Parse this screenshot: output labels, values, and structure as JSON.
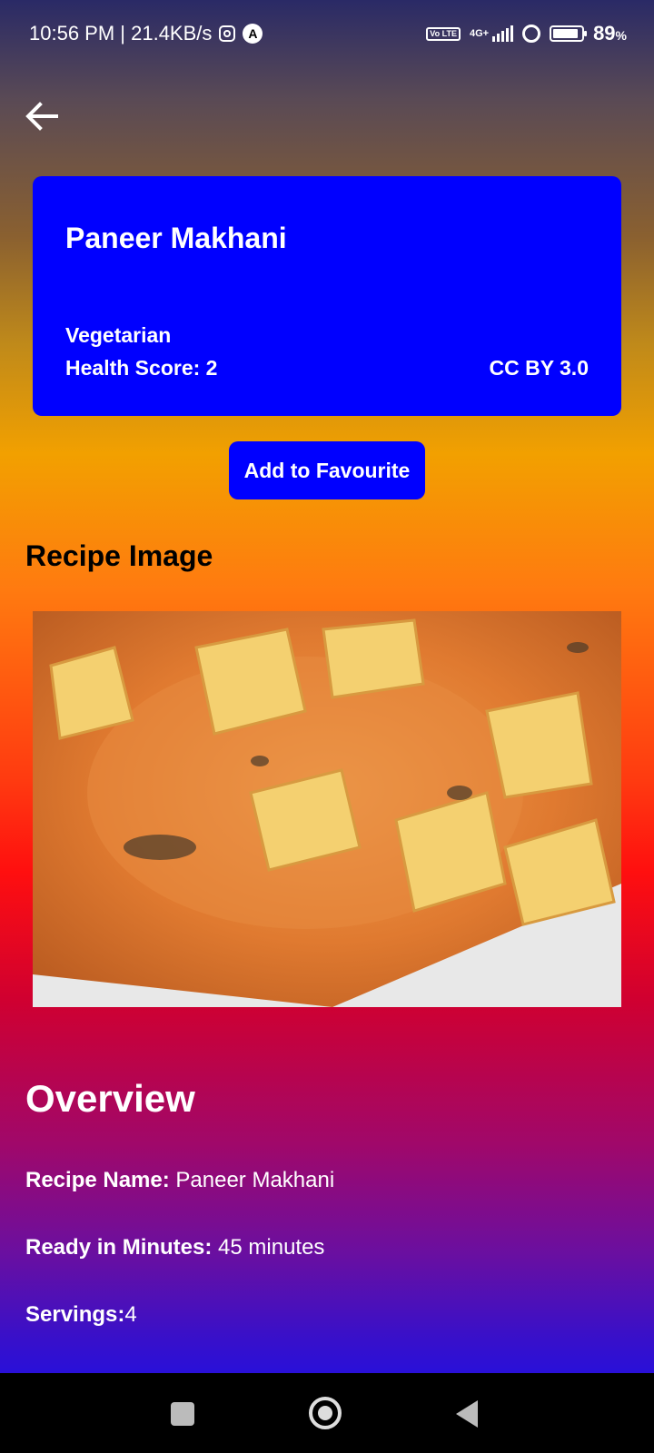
{
  "status_bar": {
    "time_speed": "10:56 PM | 21.4KB/s",
    "network_badge": "Vo LTE",
    "network_type": "4G+",
    "battery_value": "89",
    "battery_unit": "%",
    "icons": [
      "instagram-icon",
      "a-app-icon",
      "volte-icon",
      "signal-icon",
      "loop-icon",
      "battery-icon"
    ]
  },
  "recipe": {
    "title": "Paneer Makhani",
    "diet": "Vegetarian",
    "health_score": "Health Score: 2",
    "license": "CC BY 3.0"
  },
  "actions": {
    "favourite_label": "Add to Favourite"
  },
  "image_section": {
    "heading": "Recipe Image"
  },
  "overview": {
    "heading": "Overview",
    "name_label": "Recipe Name:",
    "name_value": " Paneer Makhani",
    "time_label": "Ready in Minutes:",
    "time_value": " 45 minutes",
    "servings_label": "Servings:",
    "servings_value": "4"
  },
  "colors": {
    "card_blue": "#0000ff",
    "nav_bar": "#000000"
  }
}
